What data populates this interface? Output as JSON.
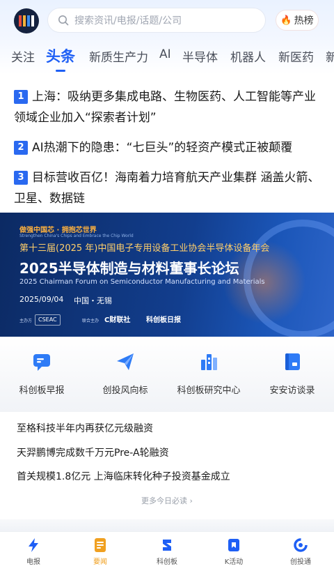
{
  "header": {
    "search_placeholder": "搜索资讯/电报/话题/公司",
    "hot_label": "热榜"
  },
  "tabs": [
    {
      "label": "关注"
    },
    {
      "label": "头条"
    },
    {
      "label": "新质生产力"
    },
    {
      "label": "AI"
    },
    {
      "label": "半导体"
    },
    {
      "label": "机器人"
    },
    {
      "label": "新医药"
    },
    {
      "label": "新"
    }
  ],
  "active_tab": "头条",
  "headlines": [
    {
      "rank": "1",
      "text": "上海：吸纳更多集成电路、生物医药、人工智能等产业领域企业加入“探索者计划”"
    },
    {
      "rank": "2",
      "text": "AI热潮下的隐患：“七巨头”的轻资产模式正被颠覆"
    },
    {
      "rank": "3",
      "text": "目标营收百亿！海南着力培育航天产业集群 涵盖火箭、卫星、数据链"
    }
  ],
  "banner": {
    "tagline": "做强中国芯 · 拥抱芯世界",
    "tagline_en": "Strengthen China's Chips and Embrace the Chip World",
    "subtitle": "第十三届(2025 年)中国电子专用设备工业协会半导体设备年会",
    "title": "2025半导体制造与材料董事长论坛",
    "title_en": "2025 Chairman Forum on Semiconductor Manufacturing and Materials",
    "date": "2025/09/04",
    "city": "中国・无锡",
    "organizer_label": "主办方",
    "organizer": "CSEAC",
    "co_label": "联合主办",
    "co_org_1": "C财联社",
    "co_org_2": "科创板日报"
  },
  "quick_entries": [
    {
      "label": "科创板早报",
      "icon": "chat-bubble-icon"
    },
    {
      "label": "创投风向标",
      "icon": "paper-plane-icon"
    },
    {
      "label": "科创板研究中心",
      "icon": "building-chart-icon"
    },
    {
      "label": "安安访谈录",
      "icon": "notebook-icon"
    }
  ],
  "news": [
    {
      "text": "至格科技半年内再获亿元级融资"
    },
    {
      "text": "天羿鹏博完成数千万元Pre-A轮融资"
    },
    {
      "text": "首关规模1.8亿元 上海临床转化种子投资基金成立"
    }
  ],
  "more_label": "更多今日必读 ›",
  "bottom_nav": [
    {
      "label": "电报",
      "icon": "lightning-icon"
    },
    {
      "label": "要闻",
      "icon": "news-icon"
    },
    {
      "label": "科创板",
      "icon": "kechuang-icon"
    },
    {
      "label": "K活动",
      "icon": "k-activity-icon"
    },
    {
      "label": "创投通",
      "icon": "chuangtou-icon"
    }
  ],
  "active_nav": "要闻",
  "colors": {
    "accent": "#1e5ff5",
    "rank_badge": "#2a69f0",
    "nav_active": "#f0a020",
    "banner_bg": "#123e8e"
  }
}
